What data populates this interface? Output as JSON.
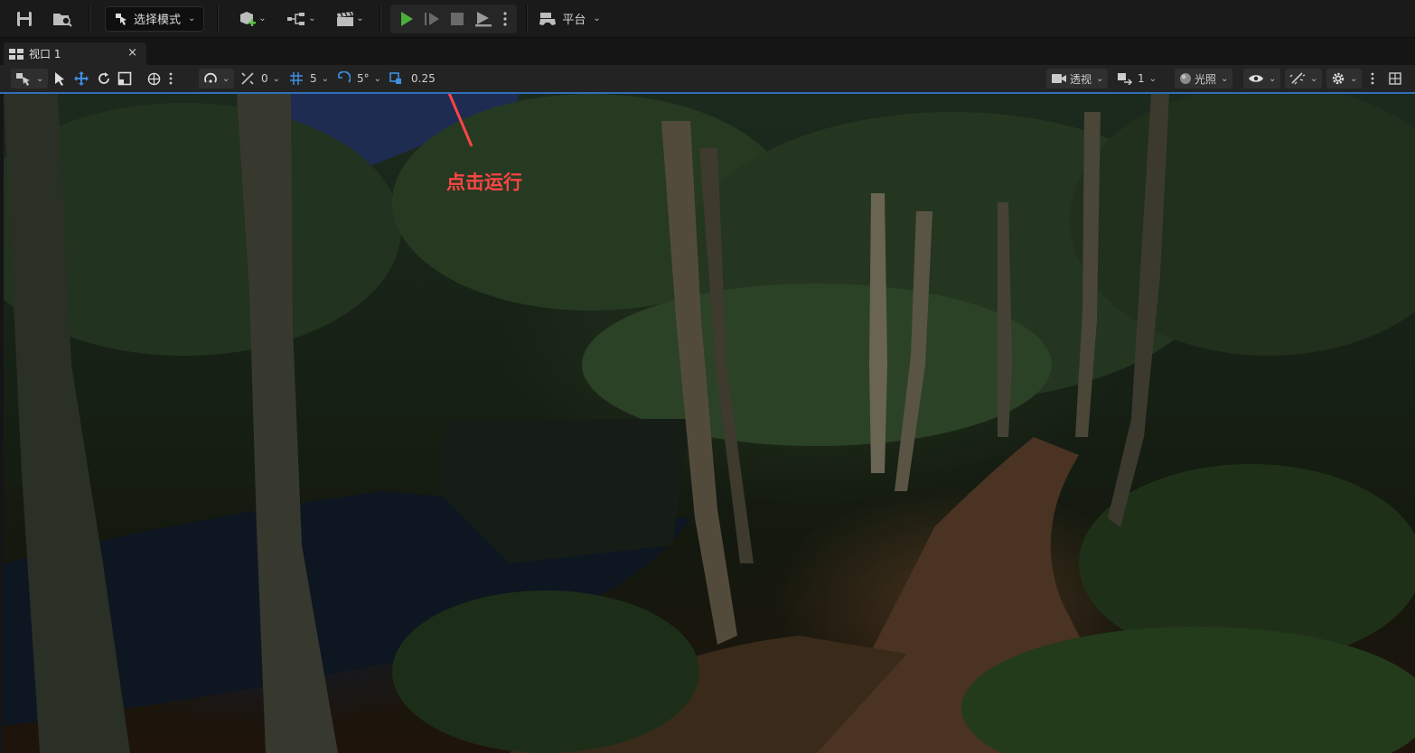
{
  "toolbar": {
    "mode_label": "选择模式",
    "platform_label": "平台"
  },
  "viewport_tab": {
    "title": "视口 1",
    "close": "×"
  },
  "viewport_toolbar": {
    "translate_snap": "0",
    "grid_snap": "5",
    "rotate_snap": "5°",
    "scale_snap": "0.25",
    "view_type": "透视",
    "camera_speed": "1",
    "view_mode": "光照"
  },
  "annotation": {
    "label": "点击运行",
    "color": "#ff4444"
  },
  "colors": {
    "play_green": "#4caf3a",
    "accent_blue": "#2f6fb8"
  }
}
